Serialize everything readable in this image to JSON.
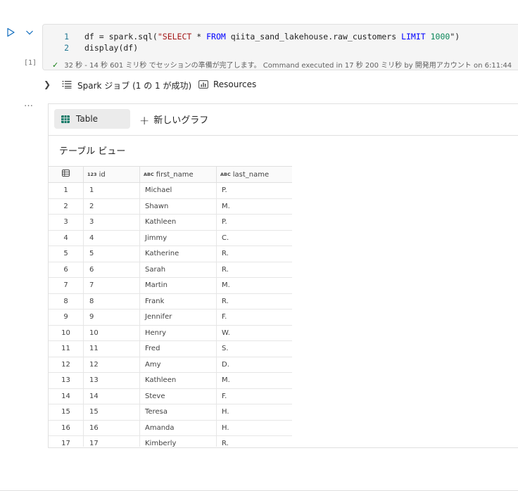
{
  "cell": {
    "execution_count": "[1]",
    "code_lines": [
      {
        "n": "1",
        "tokens": [
          {
            "t": "df = spark.sql(",
            "k": "plain"
          },
          {
            "t": "\"SELECT ",
            "k": "str"
          },
          {
            "t": "* ",
            "k": "plain"
          },
          {
            "t": "FROM ",
            "k": "kw"
          },
          {
            "t": "qiita_sand_lakehouse.raw_customers ",
            "k": "plain"
          },
          {
            "t": "LIMIT ",
            "k": "kw"
          },
          {
            "t": "1000",
            "k": "num"
          },
          {
            "t": "\")",
            "k": "plain"
          }
        ]
      },
      {
        "n": "2",
        "tokens": [
          {
            "t": "display(df)",
            "k": "plain"
          }
        ]
      }
    ],
    "status_text": "32 秒 - 14 秒 601 ミリ秒 でセッションの準備が完了します。 Command executed in 17 秒 200 ミリ秒 by 開発用アカウント on 6:11:44",
    "more_label": "…"
  },
  "spark_jobs": {
    "label": "Spark ジョブ (1 の 1 が成功)",
    "resources_label": "Resources"
  },
  "output": {
    "tab_table_label": "Table",
    "new_graph_label": "新しいグラフ",
    "table_title": "テーブル ビュー",
    "columns": [
      {
        "type": "123",
        "name": "id"
      },
      {
        "type": "ABC",
        "name": "first_name"
      },
      {
        "type": "ABC",
        "name": "last_name"
      }
    ],
    "rows": [
      [
        "1",
        "1",
        "Michael",
        "P."
      ],
      [
        "2",
        "2",
        "Shawn",
        "M."
      ],
      [
        "3",
        "3",
        "Kathleen",
        "P."
      ],
      [
        "4",
        "4",
        "Jimmy",
        "C."
      ],
      [
        "5",
        "5",
        "Katherine",
        "R."
      ],
      [
        "6",
        "6",
        "Sarah",
        "R."
      ],
      [
        "7",
        "7",
        "Martin",
        "M."
      ],
      [
        "8",
        "8",
        "Frank",
        "R."
      ],
      [
        "9",
        "9",
        "Jennifer",
        "F."
      ],
      [
        "10",
        "10",
        "Henry",
        "W."
      ],
      [
        "11",
        "11",
        "Fred",
        "S."
      ],
      [
        "12",
        "12",
        "Amy",
        "D."
      ],
      [
        "13",
        "13",
        "Kathleen",
        "M."
      ],
      [
        "14",
        "14",
        "Steve",
        "F."
      ],
      [
        "15",
        "15",
        "Teresa",
        "H."
      ],
      [
        "16",
        "16",
        "Amanda",
        "H."
      ],
      [
        "17",
        "17",
        "Kimberly",
        "R."
      ]
    ]
  },
  "colors": {
    "accent_blue": "#0f6cbd",
    "success_green": "#107c10",
    "table_icon_green": "#117865"
  },
  "icons": [
    "run-icon",
    "chevron-down-icon",
    "check-icon",
    "chevron-right-icon",
    "job-list-icon",
    "resources-icon",
    "table-grid-icon",
    "plus-icon"
  ]
}
